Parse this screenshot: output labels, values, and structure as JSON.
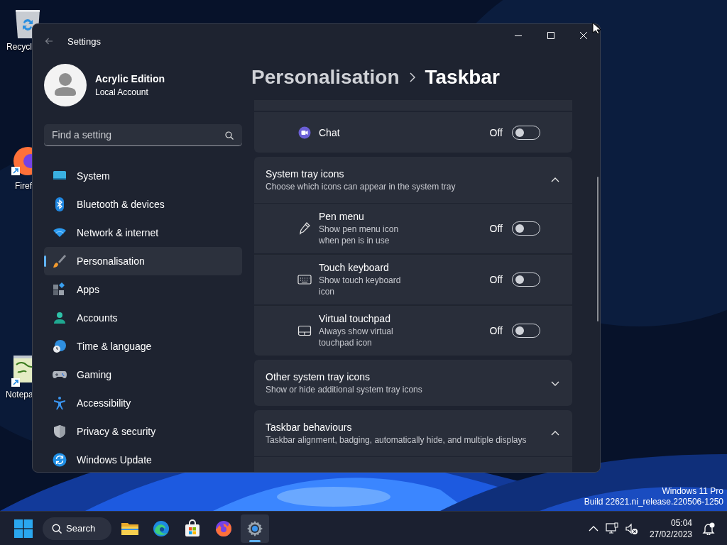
{
  "desktop": {
    "icons": [
      {
        "label": "Recycl"
      },
      {
        "label": "Firef"
      },
      {
        "label": "Notepa"
      }
    ],
    "watermark": [
      "Windows 11 Pro",
      "Build 22621.ni_release.220506-1250"
    ]
  },
  "window": {
    "title": "Settings"
  },
  "sidebar": {
    "account": {
      "name": "Acrylic Edition",
      "type": "Local Account"
    },
    "search": {
      "placeholder": "Find a setting"
    },
    "items": [
      {
        "label": "System",
        "selected": false
      },
      {
        "label": "Bluetooth & devices",
        "selected": false
      },
      {
        "label": "Network & internet",
        "selected": false
      },
      {
        "label": "Personalisation",
        "selected": true
      },
      {
        "label": "Apps",
        "selected": false
      },
      {
        "label": "Accounts",
        "selected": false
      },
      {
        "label": "Time & language",
        "selected": false
      },
      {
        "label": "Gaming",
        "selected": false
      },
      {
        "label": "Accessibility",
        "selected": false
      },
      {
        "label": "Privacy & security",
        "selected": false
      },
      {
        "label": "Windows Update",
        "selected": false
      }
    ]
  },
  "content": {
    "breadcrumb": [
      "Personalisation",
      "Taskbar"
    ],
    "sections": [
      {
        "kind": "rows",
        "rows": [
          {
            "label": "Chat",
            "state_text": "Off",
            "on": false
          }
        ]
      },
      {
        "kind": "expander",
        "title": "System tray icons",
        "description": "Choose which icons can appear in the system tray",
        "expanded": true,
        "rows": [
          {
            "label": "Pen menu",
            "description": "Show pen menu icon when pen is in use",
            "state_text": "Off",
            "on": false
          },
          {
            "label": "Touch keyboard",
            "description": "Show touch keyboard icon",
            "state_text": "Off",
            "on": false
          },
          {
            "label": "Virtual touchpad",
            "description": "Always show virtual touchpad icon",
            "state_text": "Off",
            "on": false
          }
        ]
      },
      {
        "kind": "expander",
        "title": "Other system tray icons",
        "description": "Show or hide additional system tray icons",
        "expanded": false
      },
      {
        "kind": "expander",
        "title": "Taskbar behaviours",
        "description": "Taskbar alignment, badging, automatically hide, and multiple displays",
        "expanded": true
      }
    ]
  },
  "taskbar": {
    "search_label": "Search",
    "apps": [
      {
        "selected": false
      },
      {
        "selected": false
      },
      {
        "selected": false
      },
      {
        "selected": false
      },
      {
        "selected": true
      }
    ],
    "clock": {
      "time": "05:04",
      "date": "27/02/2023"
    }
  }
}
